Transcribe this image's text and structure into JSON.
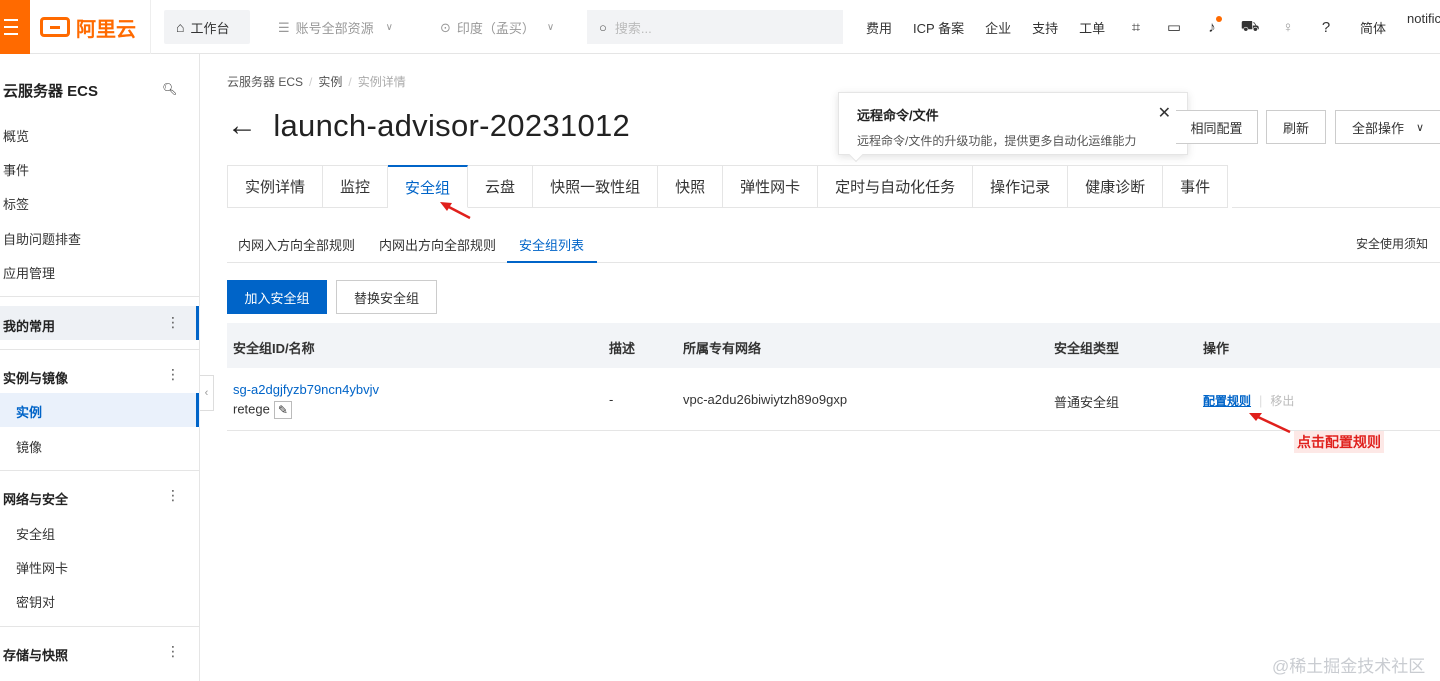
{
  "topbar": {
    "brand": "阿里云",
    "workbench": "工作台",
    "resource_scope": "账号全部资源",
    "region": "印度（孟买）",
    "search_placeholder": "搜索...",
    "links": [
      "费用",
      "ICP 备案",
      "企业",
      "支持",
      "工单"
    ],
    "icons": [
      "app-icon",
      "terminal-icon",
      "bell-icon",
      "cart-icon",
      "lightbulb-icon",
      "help-icon"
    ],
    "language": "简体",
    "user": "notific"
  },
  "sidebar": {
    "title": "云服务器 ECS",
    "items": [
      "概览",
      "事件",
      "标签",
      "自助问题排查",
      "应用管理"
    ],
    "favorites": "我的常用",
    "groups": [
      {
        "label": "实例与镜像",
        "children": [
          "实例",
          "镜像"
        ]
      },
      {
        "label": "网络与安全",
        "children": [
          "安全组",
          "弹性网卡",
          "密钥对"
        ]
      },
      {
        "label": "存储与快照",
        "children": []
      }
    ]
  },
  "breadcrumb": [
    "云服务器 ECS",
    "实例",
    "实例详情"
  ],
  "page": {
    "title": "launch-advisor-20231012"
  },
  "popover": {
    "title": "远程命令/文件",
    "desc": "远程命令/文件的升级功能，提供更多自动化运维能力"
  },
  "header_buttons": {
    "same_config": "相同配置",
    "refresh": "刷新",
    "all_actions": "全部操作"
  },
  "tabs": [
    "实例详情",
    "监控",
    "安全组",
    "云盘",
    "快照一致性组",
    "快照",
    "弹性网卡",
    "定时与自动化任务",
    "操作记录",
    "健康诊断",
    "事件"
  ],
  "active_tab": "安全组",
  "subtabs": [
    "内网入方向全部规则",
    "内网出方向全部规则",
    "安全组列表"
  ],
  "active_subtab": "安全组列表",
  "security_notice": "安全使用须知",
  "actions": {
    "join": "加入安全组",
    "replace": "替换安全组"
  },
  "table": {
    "columns": [
      "安全组ID/名称",
      "描述",
      "所属专有网络",
      "安全组类型",
      "操作"
    ],
    "rows": [
      {
        "id": "sg-a2dgjfyzb79ncn4ybvjv",
        "name": "retege",
        "desc": "-",
        "vpc": "vpc-a2du26biwiytzh89o9gxp",
        "type": "普通安全组",
        "action_config": "配置规则",
        "action_remove": "移出"
      }
    ]
  },
  "annotation": "点击配置规则",
  "watermark": "@稀土掘金技术社区",
  "colors": {
    "brand": "#ff6a00",
    "primary": "#0064c8",
    "annotation": "#e0201c"
  }
}
